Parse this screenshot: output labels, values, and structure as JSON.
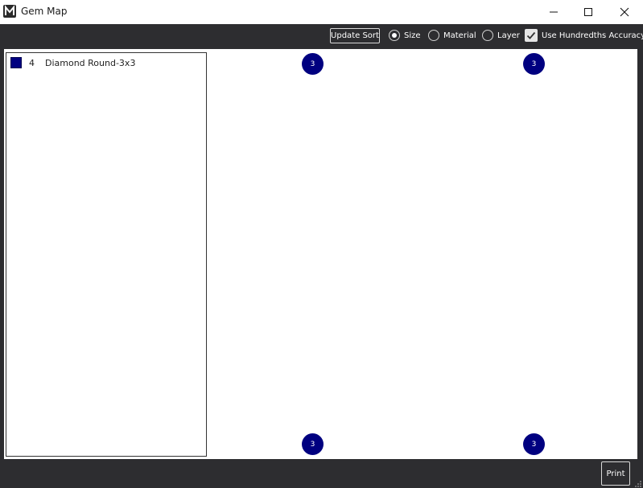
{
  "window": {
    "title": "Gem Map",
    "logo_icon": "app-logo-m-icon",
    "controls": [
      "minimize-icon",
      "maximize-icon",
      "close-icon"
    ]
  },
  "toolbar": {
    "update_sort_label": "Update Sort",
    "sort_options": [
      {
        "label": "Size",
        "selected": true
      },
      {
        "label": "Material",
        "selected": false
      },
      {
        "label": "Layer",
        "selected": false
      }
    ],
    "hundredths": {
      "label": "Use Hundredths Accuracy",
      "checked": true
    }
  },
  "gem_list": {
    "items": [
      {
        "count": "4",
        "label": "Diamond Round-3x3",
        "color": "#000080"
      }
    ]
  },
  "map": {
    "marker_color": "#000080",
    "markers": [
      {
        "label": "3"
      },
      {
        "label": "3"
      },
      {
        "label": "3"
      },
      {
        "label": "3"
      }
    ]
  },
  "footer": {
    "print_label": "Print"
  },
  "colors": {
    "chrome_background": "#2d2d30",
    "canvas_background": "#ffffff",
    "gem_navy": "#000080"
  }
}
